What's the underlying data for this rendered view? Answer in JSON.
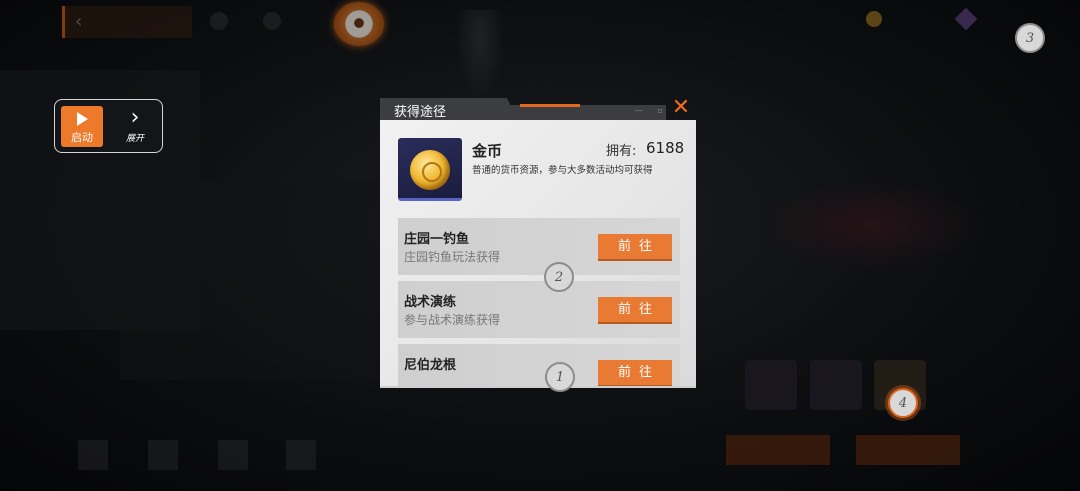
{
  "background": {
    "step_markers": [
      "3",
      "2",
      "1",
      "4"
    ]
  },
  "start_widget": {
    "start_label": "启动",
    "expand_label": "展开"
  },
  "modal": {
    "title": "获得途径",
    "item": {
      "name": "金币",
      "owned_label": "拥有:",
      "owned_value": "6188",
      "description": "普通的货币资源，参与大多数活动均可获得"
    },
    "sources": [
      {
        "name": "庄园一钓鱼",
        "subtitle": "庄园钓鱼玩法获得",
        "button": "前往"
      },
      {
        "name": "战术演练",
        "subtitle": "参与战术演练获得",
        "button": "前往"
      },
      {
        "name": "尼伯龙根",
        "subtitle": "",
        "button": "前往"
      }
    ]
  },
  "colors": {
    "accent": "#e87a33",
    "close": "#ee6a20"
  }
}
